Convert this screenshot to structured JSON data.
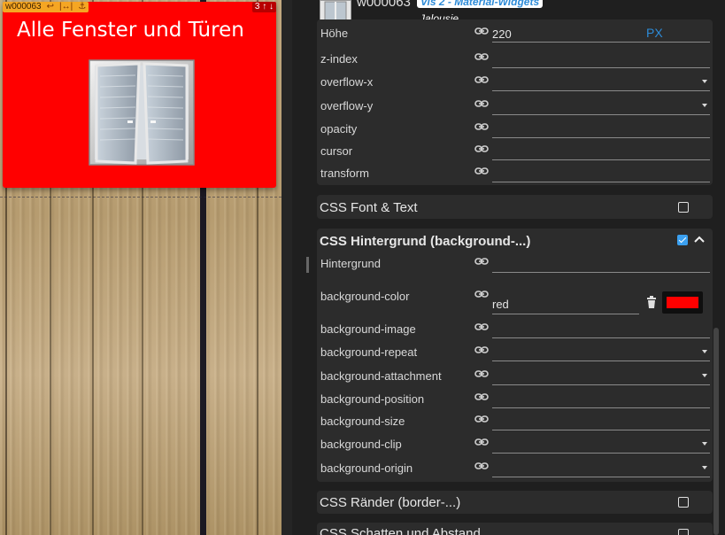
{
  "canvas": {
    "widget": {
      "id_tag": "w000063",
      "badge": "3 ↑ ↓",
      "title": "Alle Fenster und Türen",
      "background": "#ff0000",
      "icon": "double-window-icon"
    }
  },
  "inspector": {
    "header": {
      "widget_id": "w000063",
      "widget_set": "Vis 2 - Material-Widgets",
      "widget_type": "Jalousie"
    },
    "common_section": {
      "rows": [
        {
          "label": "Höhe",
          "value": "220",
          "unit": "PX",
          "type": "text"
        },
        {
          "label": "z-index",
          "value": "",
          "type": "text"
        },
        {
          "label": "overflow-x",
          "value": "",
          "type": "select"
        },
        {
          "label": "overflow-y",
          "value": "",
          "type": "select"
        },
        {
          "label": "opacity",
          "value": "",
          "type": "text"
        },
        {
          "label": "cursor",
          "value": "",
          "type": "text"
        },
        {
          "label": "transform",
          "value": "",
          "type": "text"
        }
      ]
    },
    "font_section": {
      "title": "CSS Font & Text",
      "checked": false
    },
    "background_section": {
      "title": "CSS Hintergrund (background-...)",
      "checked": true,
      "rows": [
        {
          "label": "Hintergrund",
          "value": "",
          "type": "text"
        },
        {
          "label": "background-color",
          "value": "red",
          "type": "color",
          "swatch": "#ff0000"
        },
        {
          "label": "background-image",
          "value": "",
          "type": "text"
        },
        {
          "label": "background-repeat",
          "value": "",
          "type": "select"
        },
        {
          "label": "background-attachment",
          "value": "",
          "type": "select"
        },
        {
          "label": "background-position",
          "value": "",
          "type": "text"
        },
        {
          "label": "background-size",
          "value": "",
          "type": "text"
        },
        {
          "label": "background-clip",
          "value": "",
          "type": "select"
        },
        {
          "label": "background-origin",
          "value": "",
          "type": "select"
        }
      ]
    },
    "border_section": {
      "title": "CSS Ränder (border-...)",
      "checked": false
    },
    "shadow_section": {
      "title": "CSS Schatten und Abstand",
      "checked": false
    }
  },
  "colors": {
    "accent": "#2d8bd8",
    "panel": "#2c2c2c",
    "widget_bg": "#ff0000"
  }
}
